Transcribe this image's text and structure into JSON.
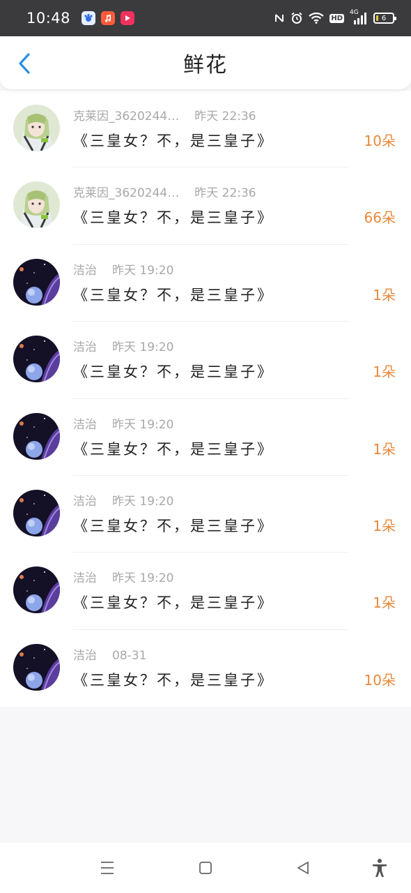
{
  "status_bar": {
    "time": "10:48",
    "network": "4G",
    "hd_label": "HD",
    "battery": "6"
  },
  "header": {
    "title": "鲜花",
    "back_icon": "chevron-left-icon"
  },
  "colors": {
    "accent": "#2a8fe0",
    "count": "#e8883a",
    "meta": "#a8a8a8",
    "status_bg": "#3b3b3d"
  },
  "records": [
    {
      "name": "克莱因_3620244…",
      "time": "昨天 22:36",
      "title": "《三皇女？不，是三皇子》",
      "count": "10朵",
      "avatar": "anime-character"
    },
    {
      "name": "克莱因_3620244…",
      "time": "昨天 22:36",
      "title": "《三皇女？不，是三皇子》",
      "count": "66朵",
      "avatar": "anime-character"
    },
    {
      "name": "洁治",
      "time": "昨天 19:20",
      "title": "《三皇女？不，是三皇子》",
      "count": "1朵",
      "avatar": "planet-space"
    },
    {
      "name": "洁治",
      "time": "昨天 19:20",
      "title": "《三皇女？不，是三皇子》",
      "count": "1朵",
      "avatar": "planet-space"
    },
    {
      "name": "洁治",
      "time": "昨天 19:20",
      "title": "《三皇女？不，是三皇子》",
      "count": "1朵",
      "avatar": "planet-space"
    },
    {
      "name": "洁治",
      "time": "昨天 19:20",
      "title": "《三皇女？不，是三皇子》",
      "count": "1朵",
      "avatar": "planet-space"
    },
    {
      "name": "洁治",
      "time": "昨天 19:20",
      "title": "《三皇女？不，是三皇子》",
      "count": "1朵",
      "avatar": "planet-space"
    },
    {
      "name": "洁治",
      "time": "08-31",
      "title": "《三皇女？不，是三皇子》",
      "count": "10朵",
      "avatar": "planet-space"
    }
  ]
}
